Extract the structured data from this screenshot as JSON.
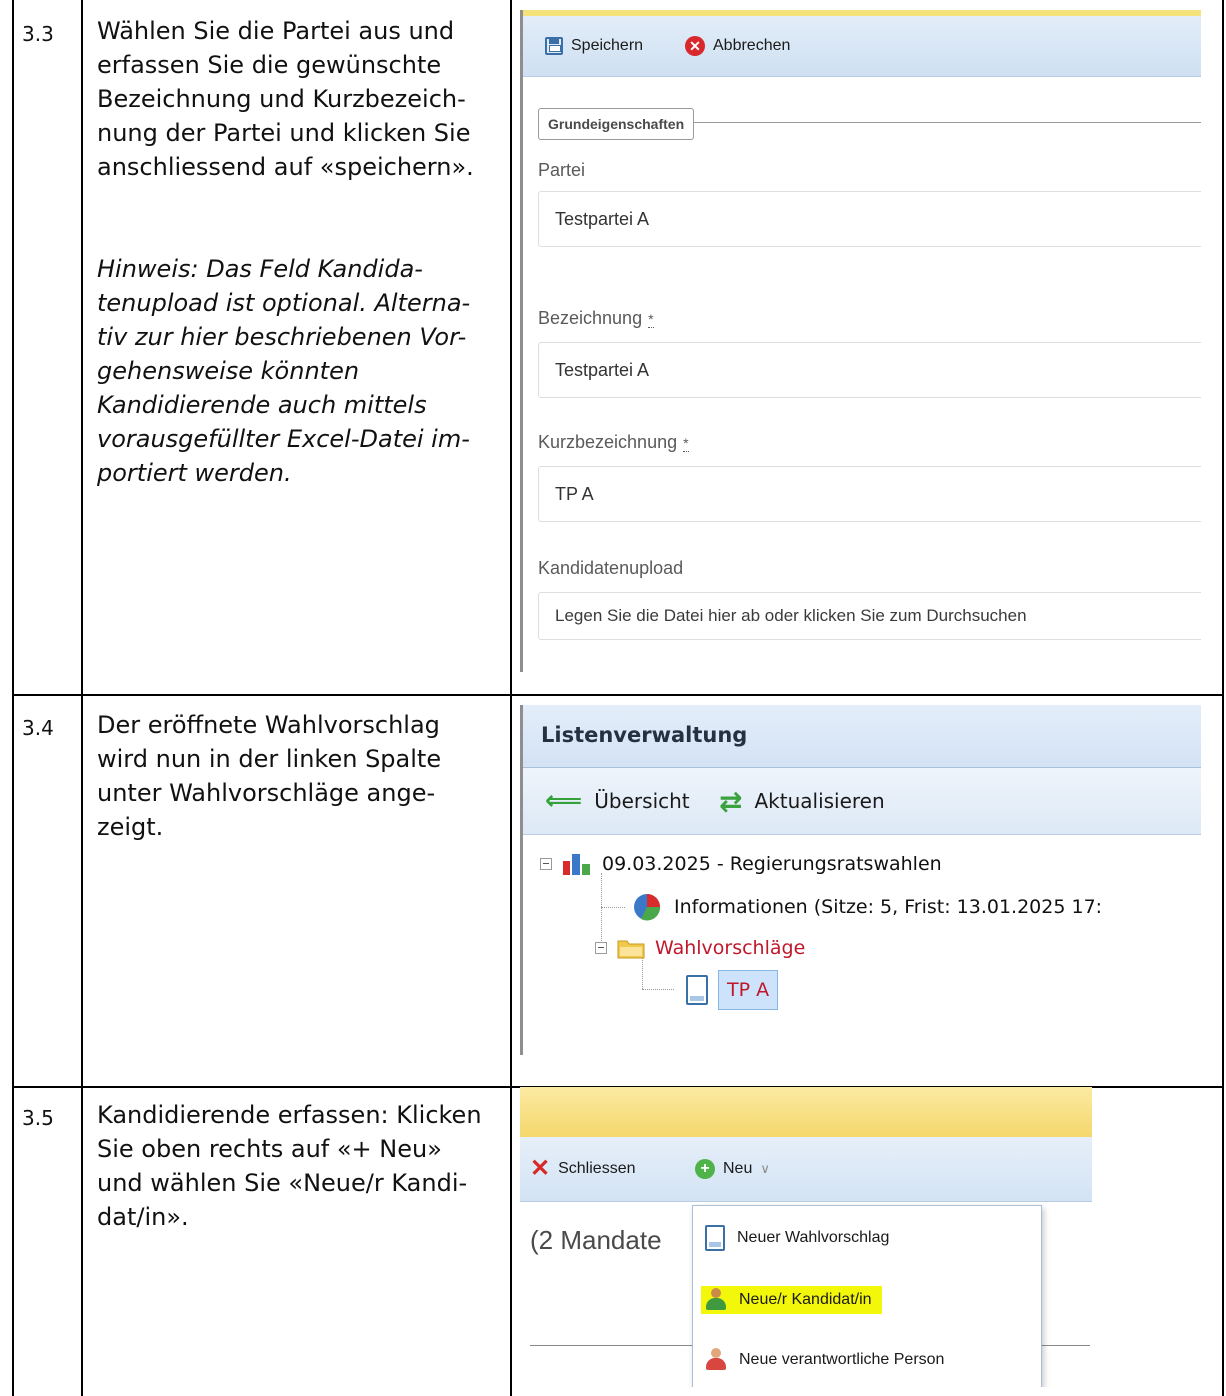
{
  "rows": [
    {
      "number": "3.3",
      "description_lines": [
        "Wählen Sie die Partei aus und",
        "erfassen Sie die gewünschte",
        "Bezeichnung und Kurzbezeich-",
        "nung der Partei und klicken Sie",
        "anschliessend auf «speichern»."
      ],
      "note_lines": [
        "Hinweis: Das Feld Kandida-",
        "tenupload ist optional. Alterna-",
        "tiv zur hier beschriebenen Vor-",
        "gehensweise könnten",
        "Kandidierende auch mittels",
        "vorausgefüllter Excel-Datei im-",
        "portiert werden."
      ]
    },
    {
      "number": "3.4",
      "description_lines": [
        "Der eröffnete Wahlvorschlag",
        "wird nun in der linken Spalte",
        "unter Wahlvorschläge ange-",
        "zeigt."
      ]
    },
    {
      "number": "3.5",
      "description_lines": [
        "Kandidierende erfassen: Klicken",
        "Sie oben rechts auf «+ Neu»",
        "und wählen Sie «Neue/r Kandi-",
        "dat/in»."
      ]
    }
  ],
  "form_screenshot": {
    "toolbar": {
      "save_label": "Speichern",
      "cancel_label": "Abbrechen",
      "save_icon": "floppy-disk-icon",
      "cancel_icon": "red-x-circle-icon"
    },
    "fieldset_legend": "Grundeigenschaften",
    "fields": {
      "partei": {
        "label": "Partei",
        "value": "Testpartei A"
      },
      "bezeichnung": {
        "label": "Bezeichnung",
        "required_mark": "*",
        "value": "Testpartei A"
      },
      "kurzbezeichnung": {
        "label": "Kurzbezeichnung",
        "required_mark": "*",
        "value": "TP A"
      },
      "kandidatenupload": {
        "label": "Kandidatenupload",
        "placeholder": "Legen Sie die Datei hier ab oder klicken Sie zum Durchsuchen"
      }
    }
  },
  "tree_screenshot": {
    "header_title": "Listenverwaltung",
    "toolbar": {
      "overview_label": "Übersicht",
      "refresh_label": "Aktualisieren",
      "overview_icon": "green-arrow-left-icon",
      "refresh_icon": "green-refresh-arrows-icon"
    },
    "tree": {
      "root_label": "09.03.2025 - Regierungsratswahlen",
      "info_label": "Informationen (Sitze: 5, Frist: 13.01.2025 17:",
      "folder_label": "Wahlvorschläge",
      "selected_item_label": "TP A"
    },
    "colors": {
      "folder_label": "#c0182a",
      "selected_bg": "#cce3fb"
    }
  },
  "menu_screenshot": {
    "toolbar": {
      "close_label": "Schliessen",
      "new_label": "Neu",
      "close_icon": "red-x-icon",
      "new_icon": "green-plus-circle-icon"
    },
    "background_text": "(2 Mandate",
    "menu_items": [
      {
        "label": "Neuer Wahlvorschlag",
        "icon": "document-icon"
      },
      {
        "label": "Neue/r Kandidat/in",
        "icon": "green-person-icon",
        "highlighted": true
      },
      {
        "label": "Neue verantwortliche Person",
        "icon": "red-person-icon"
      }
    ],
    "colors": {
      "highlight": "#f3f70a"
    }
  }
}
